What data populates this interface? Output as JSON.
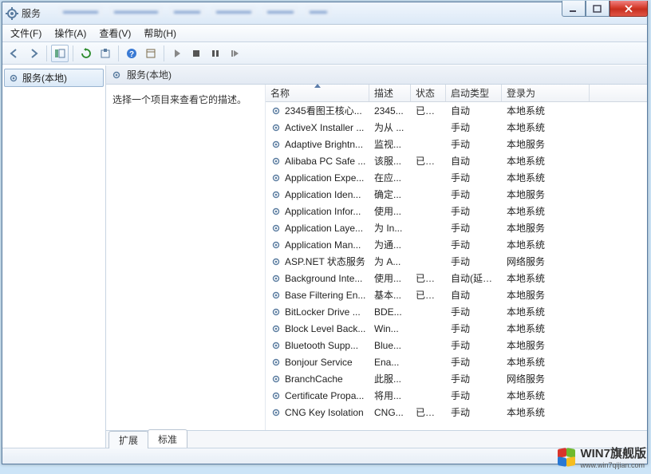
{
  "window": {
    "title": "服务"
  },
  "menus": {
    "file": "文件(F)",
    "action": "操作(A)",
    "view": "查看(V)",
    "help": "帮助(H)"
  },
  "tree": {
    "root": "服务(本地)"
  },
  "right_header": "服务(本地)",
  "desc_pane": {
    "prompt": "选择一个项目来查看它的描述。"
  },
  "columns": {
    "name": "名称",
    "desc": "描述",
    "status": "状态",
    "startup": "启动类型",
    "logon": "登录为"
  },
  "services": [
    {
      "name": "2345看图王核心...",
      "desc": "2345...",
      "status": "已启动",
      "startup": "自动",
      "logon": "本地系统"
    },
    {
      "name": "ActiveX Installer ...",
      "desc": "为从 ...",
      "status": "",
      "startup": "手动",
      "logon": "本地系统"
    },
    {
      "name": "Adaptive Brightn...",
      "desc": "监视...",
      "status": "",
      "startup": "手动",
      "logon": "本地服务"
    },
    {
      "name": "Alibaba PC Safe ...",
      "desc": "该服...",
      "status": "已启动",
      "startup": "自动",
      "logon": "本地系统"
    },
    {
      "name": "Application Expe...",
      "desc": "在应...",
      "status": "",
      "startup": "手动",
      "logon": "本地系统"
    },
    {
      "name": "Application Iden...",
      "desc": "确定...",
      "status": "",
      "startup": "手动",
      "logon": "本地服务"
    },
    {
      "name": "Application Infor...",
      "desc": "使用...",
      "status": "",
      "startup": "手动",
      "logon": "本地系统"
    },
    {
      "name": "Application Laye...",
      "desc": "为 In...",
      "status": "",
      "startup": "手动",
      "logon": "本地服务"
    },
    {
      "name": "Application Man...",
      "desc": "为通...",
      "status": "",
      "startup": "手动",
      "logon": "本地系统"
    },
    {
      "name": "ASP.NET 状态服务",
      "desc": "为 A...",
      "status": "",
      "startup": "手动",
      "logon": "网络服务"
    },
    {
      "name": "Background Inte...",
      "desc": "使用...",
      "status": "已启动",
      "startup": "自动(延迟...",
      "logon": "本地系统"
    },
    {
      "name": "Base Filtering En...",
      "desc": "基本...",
      "status": "已启动",
      "startup": "自动",
      "logon": "本地服务"
    },
    {
      "name": "BitLocker Drive ...",
      "desc": "BDE...",
      "status": "",
      "startup": "手动",
      "logon": "本地系统"
    },
    {
      "name": "Block Level Back...",
      "desc": "Win...",
      "status": "",
      "startup": "手动",
      "logon": "本地系统"
    },
    {
      "name": "Bluetooth Supp...",
      "desc": "Blue...",
      "status": "",
      "startup": "手动",
      "logon": "本地服务"
    },
    {
      "name": "Bonjour Service",
      "desc": "Ena...",
      "status": "",
      "startup": "手动",
      "logon": "本地系统"
    },
    {
      "name": "BranchCache",
      "desc": "此服...",
      "status": "",
      "startup": "手动",
      "logon": "网络服务"
    },
    {
      "name": "Certificate Propa...",
      "desc": "将用...",
      "status": "",
      "startup": "手动",
      "logon": "本地系统"
    },
    {
      "name": "CNG Key Isolation",
      "desc": "CNG...",
      "status": "已启动",
      "startup": "手动",
      "logon": "本地系统"
    }
  ],
  "tabs": {
    "extended": "扩展",
    "standard": "标准"
  },
  "watermark": {
    "title": "WIN7旗舰版",
    "url": "www.win7qijian.com"
  }
}
